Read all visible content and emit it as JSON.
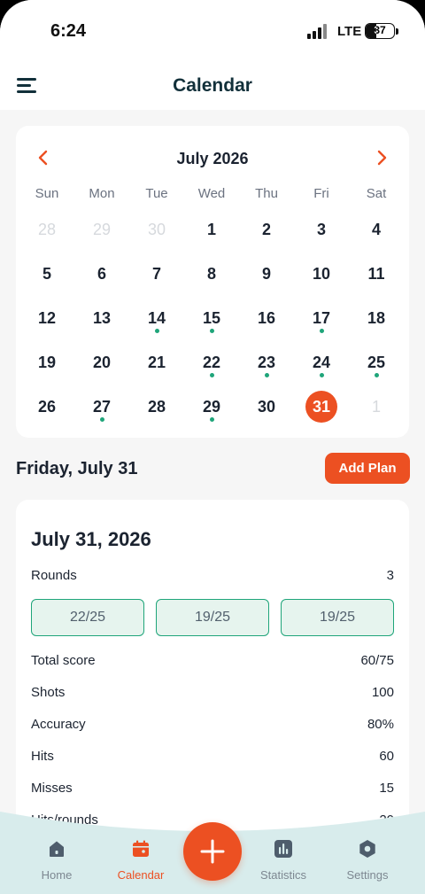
{
  "status_bar": {
    "time": "6:24",
    "network": "LTE",
    "battery": "37",
    "battery_level": 0.37
  },
  "header": {
    "title": "Calendar"
  },
  "calendar": {
    "month_label": "July 2026",
    "weekdays": [
      "Sun",
      "Mon",
      "Tue",
      "Wed",
      "Thu",
      "Fri",
      "Sat"
    ],
    "days": [
      {
        "label": "28",
        "muted": true
      },
      {
        "label": "29",
        "muted": true
      },
      {
        "label": "30",
        "muted": true
      },
      {
        "label": "1"
      },
      {
        "label": "2"
      },
      {
        "label": "3"
      },
      {
        "label": "4"
      },
      {
        "label": "5"
      },
      {
        "label": "6"
      },
      {
        "label": "7"
      },
      {
        "label": "8"
      },
      {
        "label": "9"
      },
      {
        "label": "10"
      },
      {
        "label": "11"
      },
      {
        "label": "12"
      },
      {
        "label": "13"
      },
      {
        "label": "14",
        "dot": true
      },
      {
        "label": "15",
        "dot": true
      },
      {
        "label": "16"
      },
      {
        "label": "17",
        "dot": true
      },
      {
        "label": "18"
      },
      {
        "label": "19"
      },
      {
        "label": "20"
      },
      {
        "label": "21"
      },
      {
        "label": "22",
        "dot": true
      },
      {
        "label": "23",
        "dot": true
      },
      {
        "label": "24",
        "dot": true
      },
      {
        "label": "25",
        "dot": true
      },
      {
        "label": "26"
      },
      {
        "label": "27",
        "dot": true
      },
      {
        "label": "28"
      },
      {
        "label": "29",
        "dot": true
      },
      {
        "label": "30"
      },
      {
        "label": "31",
        "selected": true
      },
      {
        "label": "1",
        "muted": true
      }
    ]
  },
  "selected_date": {
    "heading": "Friday, July 31",
    "add_plan_label": "Add Plan"
  },
  "detail": {
    "title": "July 31, 2026",
    "rounds_label": "Rounds",
    "rounds_value": "3",
    "round_scores": [
      "22/25",
      "19/25",
      "19/25"
    ],
    "stats": [
      {
        "label": "Total score",
        "value": "60/75"
      },
      {
        "label": "Shots",
        "value": "100"
      },
      {
        "label": "Accuracy",
        "value": "80%"
      },
      {
        "label": "Hits",
        "value": "60"
      },
      {
        "label": "Misses",
        "value": "15"
      },
      {
        "label": "Hits/rounds",
        "value": "20"
      }
    ]
  },
  "bottom_nav": {
    "items": [
      {
        "label": "Home",
        "icon": "home-icon"
      },
      {
        "label": "Calendar",
        "icon": "calendar-icon",
        "active": true
      },
      {
        "label": "Statistics",
        "icon": "bar-chart-icon"
      },
      {
        "label": "Settings",
        "icon": "gear-icon"
      }
    ],
    "fab_icon": "plus-icon"
  },
  "colors": {
    "accent": "#ec5022",
    "event_dot": "#1fa57a",
    "round_bg": "#e6f4ee",
    "nav_bg": "#d8ecec"
  }
}
